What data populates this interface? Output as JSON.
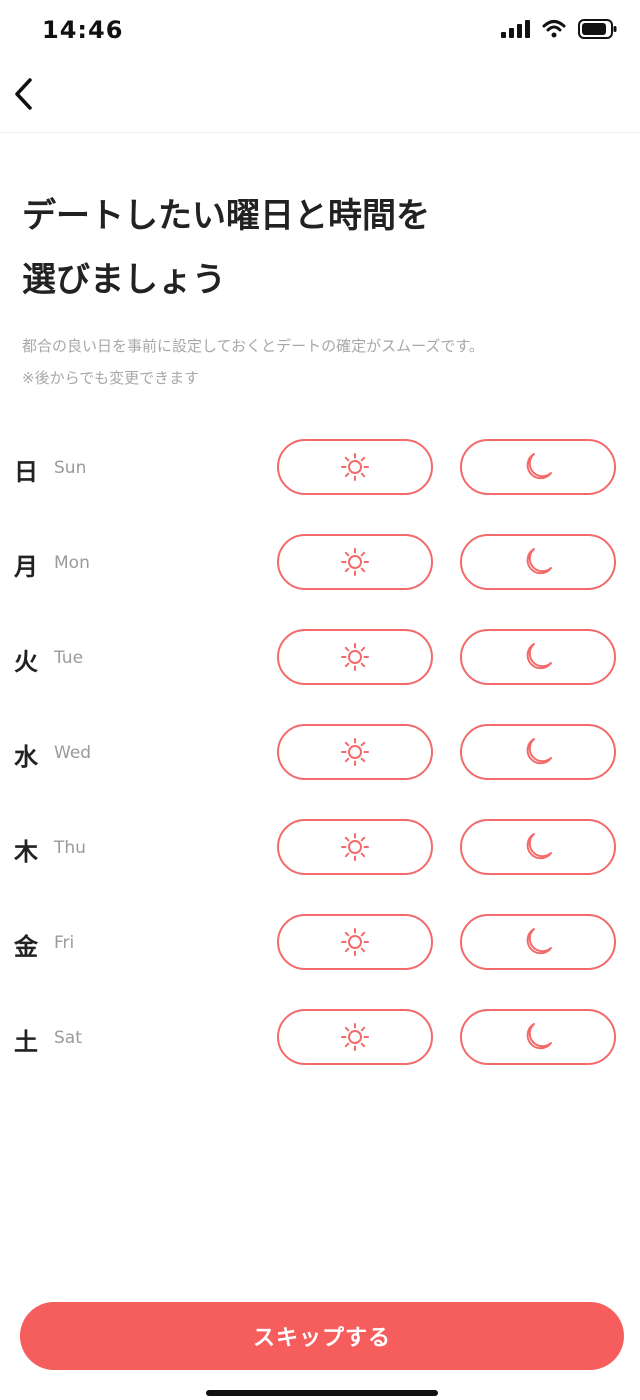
{
  "status_bar": {
    "time": "14:46"
  },
  "nav": {
    "back_icon": "chevron-left-icon"
  },
  "title": {
    "line1": "デートしたい曜日と時間を",
    "line2": "選びましょう"
  },
  "description": {
    "line1": "都合の良い日を事前に設定しておくとデートの確定がスムーズです。",
    "line2": "※後からでも変更できます"
  },
  "days": [
    {
      "kanji": "日",
      "en": "Sun"
    },
    {
      "kanji": "月",
      "en": "Mon"
    },
    {
      "kanji": "火",
      "en": "Tue"
    },
    {
      "kanji": "水",
      "en": "Wed"
    },
    {
      "kanji": "木",
      "en": "Thu"
    },
    {
      "kanji": "金",
      "en": "Fri"
    },
    {
      "kanji": "土",
      "en": "Sat"
    }
  ],
  "slots": {
    "day_icon": "sun-icon",
    "night_icon": "moon-icon"
  },
  "skip_button": {
    "label": "スキップする"
  },
  "colors": {
    "accent": "#f65d5d",
    "outline": "#f36a6a",
    "muted_text": "#a8a8a8"
  }
}
